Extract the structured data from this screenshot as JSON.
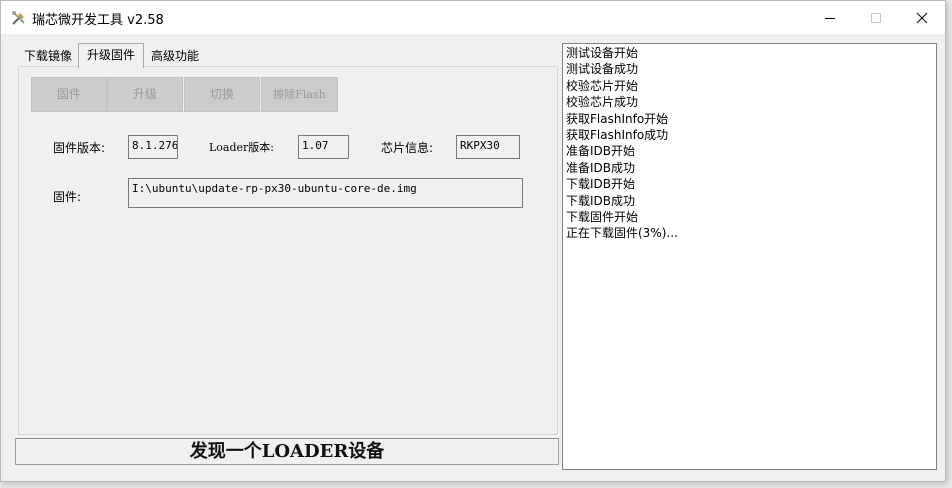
{
  "window": {
    "title": "瑞芯微开发工具 v2.58"
  },
  "tabs": [
    {
      "label": "下载镜像"
    },
    {
      "label": "升级固件"
    },
    {
      "label": "高级功能"
    }
  ],
  "toolbar": {
    "firmware_label": "固件",
    "upgrade_label": "升级",
    "switch_label": "切换",
    "erase_label": "擦除Flash"
  },
  "info": {
    "fw_version_label": "固件版本:",
    "fw_version_value": "8.1.276",
    "loader_version_label": "Loader版本:",
    "loader_version_value": "1.07",
    "chip_label": "芯片信息:",
    "chip_value": "RKPX30",
    "firmware_label": "固件:",
    "firmware_path": "I:\\ubuntu\\update-rp-px30-ubuntu-core-de.img"
  },
  "status": {
    "text": "发现一个LOADER设备"
  },
  "log": [
    "测试设备开始",
    "测试设备成功",
    "校验芯片开始",
    "校验芯片成功",
    "获取FlashInfo开始",
    "获取FlashInfo成功",
    "准备IDB开始",
    "准备IDB成功",
    "下载IDB开始",
    "下载IDB成功",
    "下载固件开始",
    "正在下载固件(3%)..."
  ]
}
